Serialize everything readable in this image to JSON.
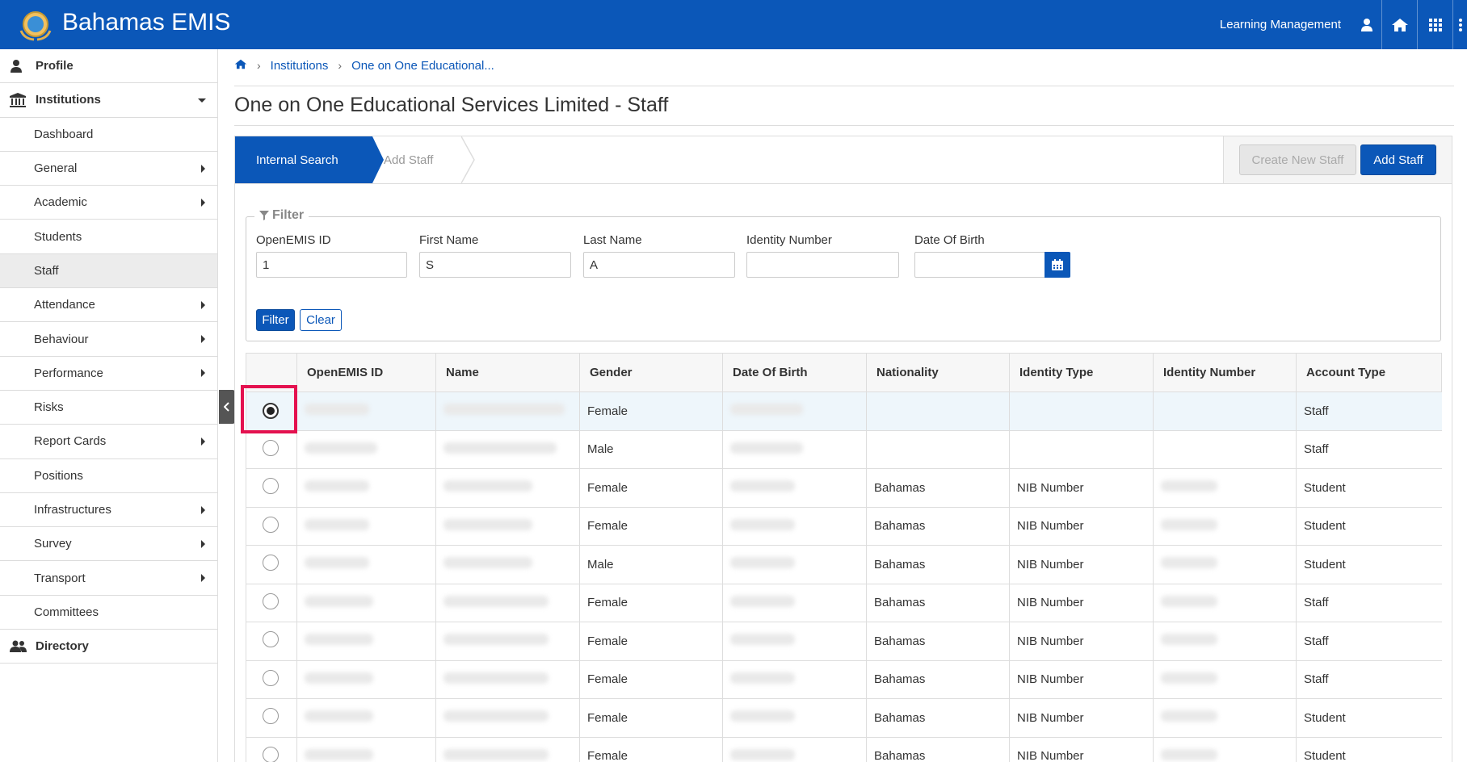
{
  "header": {
    "app_title": "Bahamas EMIS",
    "module_label": "Learning Management",
    "icons": [
      "logo-seal",
      "user-icon",
      "home-icon",
      "grid-icon",
      "more-vertical-icon"
    ]
  },
  "sidebar": {
    "profile": "Profile",
    "institutions": "Institutions",
    "directory": "Directory",
    "items": [
      {
        "label": "Dashboard",
        "submenu": false
      },
      {
        "label": "General",
        "submenu": true
      },
      {
        "label": "Academic",
        "submenu": true
      },
      {
        "label": "Students",
        "submenu": false
      },
      {
        "label": "Staff",
        "submenu": false,
        "active": true
      },
      {
        "label": "Attendance",
        "submenu": true
      },
      {
        "label": "Behaviour",
        "submenu": true
      },
      {
        "label": "Performance",
        "submenu": true
      },
      {
        "label": "Risks",
        "submenu": false
      },
      {
        "label": "Report Cards",
        "submenu": true
      },
      {
        "label": "Positions",
        "submenu": false
      },
      {
        "label": "Infrastructures",
        "submenu": true
      },
      {
        "label": "Survey",
        "submenu": true
      },
      {
        "label": "Transport",
        "submenu": true
      },
      {
        "label": "Committees",
        "submenu": false
      }
    ]
  },
  "breadcrumb": {
    "institutions": "Institutions",
    "current": "One on One Educational..."
  },
  "page_title": "One on One Educational Services Limited - Staff",
  "wizard": {
    "step1": "Internal Search",
    "step2": "Add Staff",
    "create_new_staff": "Create New Staff",
    "add_staff": "Add Staff"
  },
  "filter": {
    "legend": "Filter",
    "openemis_id_label": "OpenEMIS ID",
    "openemis_id_value": "1",
    "first_name_label": "First Name",
    "first_name_value": "S",
    "last_name_label": "Last Name",
    "last_name_value": "A",
    "identity_number_label": "Identity Number",
    "identity_number_value": "",
    "dob_label": "Date Of Birth",
    "dob_value": "",
    "filter_button": "Filter",
    "clear_button": "Clear"
  },
  "table": {
    "columns": [
      "",
      "OpenEMIS ID",
      "Name",
      "Gender",
      "Date Of Birth",
      "Nationality",
      "Identity Type",
      "Identity Number",
      "Account Type"
    ],
    "rows": [
      {
        "selected": true,
        "gender": "Female",
        "nationality": "",
        "identity_type": "",
        "account_type": "Staff"
      },
      {
        "selected": false,
        "gender": "Male",
        "nationality": "",
        "identity_type": "",
        "account_type": "Staff"
      },
      {
        "selected": false,
        "gender": "Female",
        "nationality": "Bahamas",
        "identity_type": "NIB Number",
        "account_type": "Student"
      },
      {
        "selected": false,
        "gender": "Female",
        "nationality": "Bahamas",
        "identity_type": "NIB Number",
        "account_type": "Student"
      },
      {
        "selected": false,
        "gender": "Male",
        "nationality": "Bahamas",
        "identity_type": "NIB Number",
        "account_type": "Student"
      },
      {
        "selected": false,
        "gender": "Female",
        "nationality": "Bahamas",
        "identity_type": "NIB Number",
        "account_type": "Staff"
      },
      {
        "selected": false,
        "gender": "Female",
        "nationality": "Bahamas",
        "identity_type": "NIB Number",
        "account_type": "Staff"
      },
      {
        "selected": false,
        "gender": "Female",
        "nationality": "Bahamas",
        "identity_type": "NIB Number",
        "account_type": "Staff"
      },
      {
        "selected": false,
        "gender": "Female",
        "nationality": "Bahamas",
        "identity_type": "NIB Number",
        "account_type": "Student"
      },
      {
        "selected": false,
        "gender": "Female",
        "nationality": "Bahamas",
        "identity_type": "NIB Number",
        "account_type": "Student"
      }
    ]
  },
  "colors": {
    "brand": "#0b57b8",
    "highlight": "#e4114f",
    "selected_row": "#eef6fb"
  }
}
